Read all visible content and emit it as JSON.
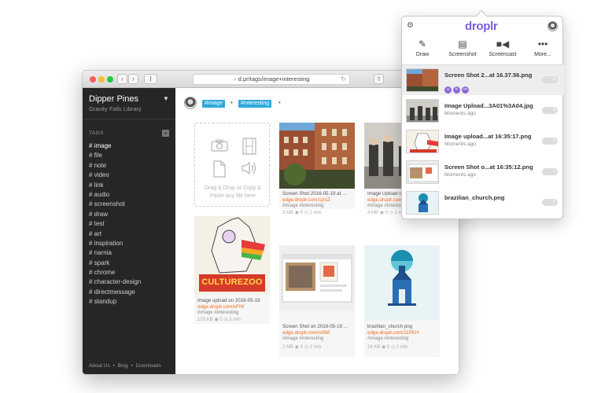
{
  "browser": {
    "url": "d.pr/tags/image+interesting"
  },
  "sidebar": {
    "title": "Dipper Pines",
    "subtitle": "Gravity Falls Library",
    "tags_heading": "TAGS",
    "tags": [
      "# image",
      "# file",
      "# note",
      "# video",
      "# link",
      "# audio",
      "# screenshot",
      "# draw",
      "# test",
      "# art",
      "# inspiration",
      "# narnia",
      "# spark",
      "# chrome",
      "# character-design",
      "# directmessage",
      "# standup"
    ],
    "footer": {
      "about": "About Us",
      "blog": "Blog",
      "downloads": "Downloads",
      "sep": "•"
    },
    "logo": "droplr"
  },
  "filter": {
    "tags": [
      "#image",
      "#interesting"
    ],
    "sep": "•"
  },
  "dropzone": {
    "text": "Drag & Drop or Copy & Paste any file here"
  },
  "cards": [
    {
      "title": "Screen Shot 2016-05-19 at ...",
      "link": "edge.droplr.com/1jzsZ",
      "tags": "#image  #interesting",
      "meta": "2 MB  ◉ 0  ◷ 2 min"
    },
    {
      "title": "Image Upload on 2016-05-19",
      "link": "edge.droplr.com/Bs6",
      "tags": "#image  #interesting",
      "meta": "4 MB  ◉ 0  ◷ 2 min"
    },
    {
      "title": "Image upload on 2016-05-19",
      "link": "edge.droplr.com/vFNf",
      "tags": "#image  #interesting",
      "meta": "103 KB  ◉ 0  ◷ 2 min"
    },
    {
      "title": "Screen Shot on 2016-05-19 ...",
      "link": "edge.droplr.com/u9Wi",
      "tags": "#image  #interesting",
      "meta": "2 MB  ◉ 0  ◷ 2 min"
    },
    {
      "title": "brazilian_church png",
      "link": "edge.droplr.com/11PEH",
      "tags": "#image  #interesting",
      "meta": "24 KB  ◉ 0  ◷ 2 min"
    }
  ],
  "popup": {
    "logo": "droplr",
    "actions": [
      {
        "label": "Draw",
        "icon": "pencil-icon"
      },
      {
        "label": "Screenshot",
        "icon": "screenshot-icon"
      },
      {
        "label": "Screencast",
        "icon": "video-camera-icon"
      },
      {
        "label": "More...",
        "icon": "more-icon"
      }
    ],
    "recent": [
      {
        "name": "Screen Shot 2...at 16.37.56.png",
        "sub": "",
        "toggle": "0"
      },
      {
        "name": "Image Upload...3A01%3A04.jpg",
        "sub": "Moments ago",
        "toggle": "0"
      },
      {
        "name": "Image upload...at 16:35:17.png",
        "sub": "Moments ago",
        "toggle": "0"
      },
      {
        "name": "Screen Shot o...at 16:35:12.png",
        "sub": "Moments ago",
        "toggle": "0"
      },
      {
        "name": "brazilian_church.png",
        "sub": "",
        "toggle": "0"
      }
    ]
  },
  "colors": {
    "accent_orange": "#f36b21",
    "tag_blue": "#2fa9de",
    "droplr_purple": "#7d5bd8",
    "sidebar_bg": "#262626"
  }
}
